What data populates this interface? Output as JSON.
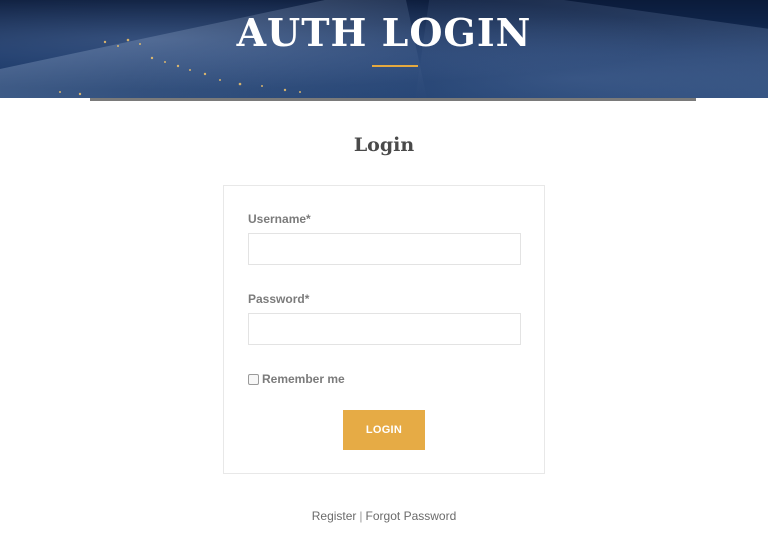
{
  "header": {
    "title": "AUTH LOGIN",
    "accent_color": "#e5a93f"
  },
  "main": {
    "heading": "Login"
  },
  "form": {
    "username_label": "Username*",
    "username_value": "",
    "password_label": "Password*",
    "password_value": "",
    "remember_label": "Remember me",
    "remember_checked": false,
    "submit_label": "LOGIN",
    "submit_color": "#e6ab45"
  },
  "footer": {
    "register_label": "Register",
    "separator": "|",
    "forgot_label": "Forgot Password"
  }
}
